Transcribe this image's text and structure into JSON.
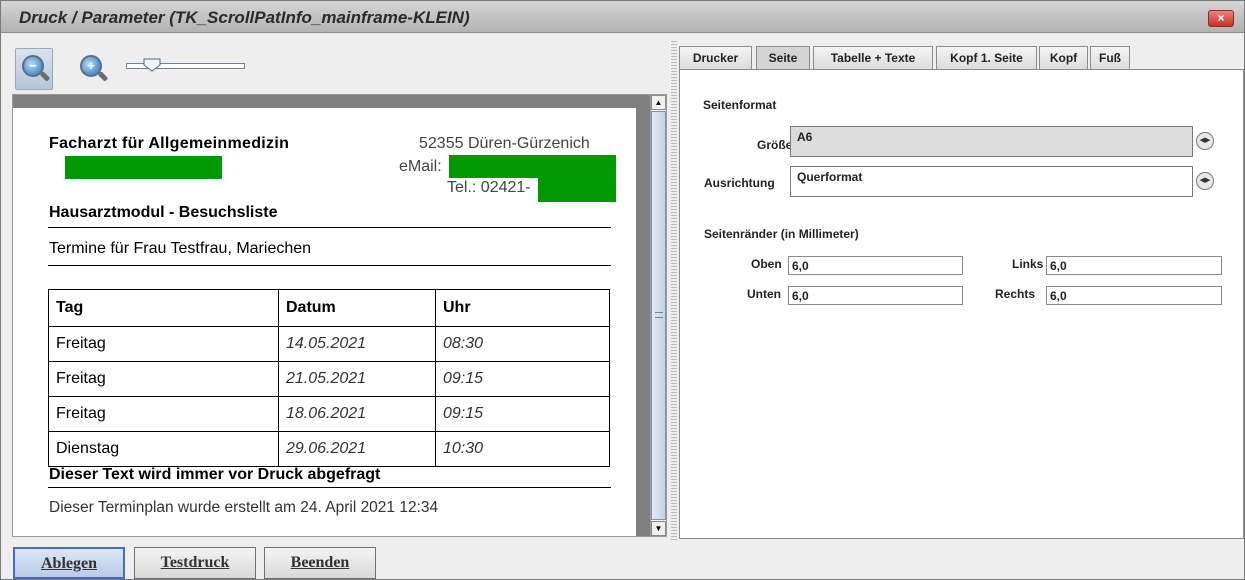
{
  "window": {
    "title": "Druck / Parameter  (TK_ScrollPatInfo_mainframe-KLEIN)",
    "close_icon": "×"
  },
  "toolbar": {
    "zoom_out_icon": "−",
    "zoom_in_icon": "+"
  },
  "preview": {
    "doctor_title": "Facharzt für Allgemeinmedizin",
    "address_city": "52355 Düren-Gürzenich",
    "email_label": "eMail:",
    "tel_label": "Tel.: 02421-",
    "module_title": "Hausarztmodul - Besuchsliste",
    "patient_line": "Termine für Frau  Testfrau, Mariechen",
    "table": {
      "headers": [
        "Tag",
        "Datum",
        "Uhr"
      ],
      "rows": [
        [
          "Freitag",
          "14.05.2021",
          "08:30"
        ],
        [
          "Freitag",
          "21.05.2021",
          "09:15"
        ],
        [
          "Freitag",
          "18.06.2021",
          "09:15"
        ],
        [
          "Dienstag",
          "29.06.2021",
          "10:30"
        ]
      ]
    },
    "query_text": "Dieser Text wird immer vor Druck abgefragt",
    "footer_text": "Dieser Terminplan wurde erstellt am 24. April 2021 12:34"
  },
  "buttons": {
    "save": "Ablegen",
    "test_print": "Testdruck",
    "exit": "Beenden"
  },
  "tabs": [
    "Drucker",
    "Seite",
    "Tabelle + Texte",
    "Kopf 1. Seite",
    "Kopf",
    "Fuß"
  ],
  "settings": {
    "section_format": "Seitenformat",
    "size_label": "Größe",
    "size_value": "A6",
    "orientation_label": "Ausrichtung",
    "orientation_value": "Querformat",
    "section_margins": "Seitenränder (in Millimeter)",
    "top_label": "Oben",
    "top_value": "6,0",
    "left_label": "Links",
    "left_value": "6,0",
    "bottom_label": "Unten",
    "bottom_value": "6,0",
    "right_label": "Rechts",
    "right_value": "6,0"
  },
  "colors": {
    "accent": "#4a6db3",
    "redacted": "#009900",
    "close": "#c9302c"
  }
}
